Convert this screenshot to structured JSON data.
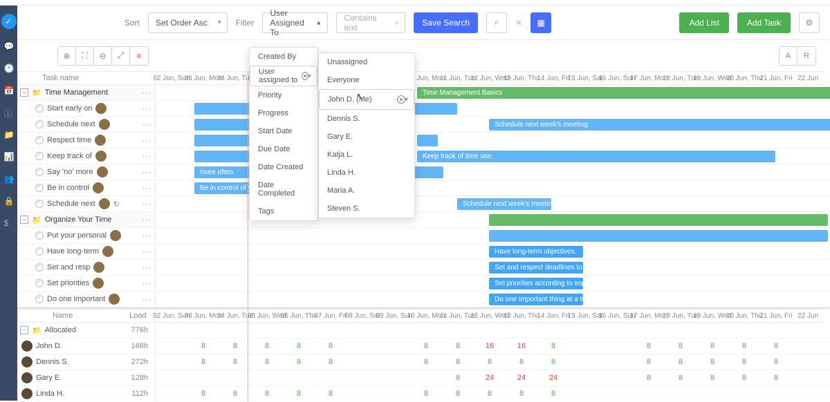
{
  "filters": {
    "sort_label": "Sort",
    "sort_value": "Set Order Asc",
    "filter_label": "Filter",
    "filter_value": "User Assigned To",
    "search_placeholder": "Contains text",
    "save_search": "Save Search",
    "add_list": "Add List",
    "add_task": "Add Task"
  },
  "toggle": {
    "a": "A",
    "r": "R"
  },
  "filter_menu": [
    "Created By",
    "User assigned to",
    "Priority",
    "Progress",
    "Start Date",
    "Due Date",
    "Date Created",
    "Date Completed",
    "Tags"
  ],
  "user_menu": [
    "Unassigned",
    "Everyone",
    "John D. (Me)",
    "Dennis S.",
    "Gary E.",
    "Katja L.",
    "Linda H.",
    "Maria A.",
    "Steven S."
  ],
  "header": {
    "task": "Task name",
    "name": "Name",
    "load": "Load"
  },
  "dates": [
    "02 Jun, Sun",
    "03 Jun, Mon",
    "04 Jun, Tue",
    "05 Jun, Wed",
    "06 Jun, Thu",
    "07 Jun, Fri",
    "08 Jun, Sat",
    "09 Jun, Sun",
    "10 Jun, Mon",
    "11 Jun, Tue",
    "12 Jun, Wed",
    "13 Jun, Thu",
    "14 Jun, Fri",
    "15 Jun, Sat",
    "16 Jun, Sun",
    "17 Jun, Mon",
    "18 Jun, Tue",
    "19 Jun, Wed",
    "20 Jun, Thu",
    "21 Jun, Fri",
    "22 Jun"
  ],
  "groups": [
    {
      "name": "Time Management"
    },
    {
      "name": "Organize Your Time"
    }
  ],
  "tasks": {
    "t0": "Start early on",
    "t1": "Schedule next",
    "t2": "Respect time",
    "t3": "Keep track of",
    "t4": "Say 'no' more",
    "t5": "Be in control",
    "t6": "Schedule next",
    "t7": "Put your personal",
    "t8": "Have long-term",
    "t9": "Set and resp",
    "t10": "Set priorities",
    "t11": "Do one important"
  },
  "bars": {
    "tm_basics": "Time Management Basics",
    "sched_meeting": "Schedule next week's meeting",
    "keep_track": "Keep track of time use.",
    "say_no": "more often.",
    "in_control": "Be in control of your own life.",
    "sched2": "Schedule next week's meeting",
    "long_term": "Have long-term objectives.",
    "deadlines": "Set and respect deadlines to complete",
    "priorities": "Set priorities according to importance",
    "one_thing": "Do one important thing at a time but many"
  },
  "alloc_header": "Allocated",
  "alloc_total": "776h",
  "users": [
    {
      "name": "John D.",
      "hrs": "168h",
      "vals": [
        "",
        "",
        "",
        "",
        "",
        "",
        "",
        "",
        "",
        "",
        "",
        "",
        "",
        "",
        "",
        "",
        "",
        "",
        "",
        "",
        ""
      ],
      "pattern": "A"
    },
    {
      "name": "Dennis S.",
      "hrs": "272h",
      "vals": [],
      "pattern": "B"
    },
    {
      "name": "Gary E.",
      "hrs": "128h",
      "vals": [],
      "pattern": "C"
    },
    {
      "name": "Linda H.",
      "hrs": "112h",
      "vals": [],
      "pattern": "D"
    }
  ]
}
